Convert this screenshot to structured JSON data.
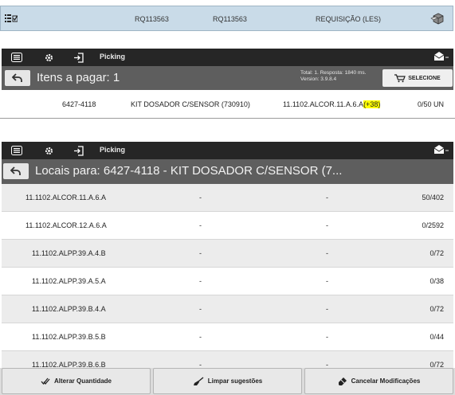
{
  "top_strip": {
    "code_1": "RQ113563",
    "code_2": "RQ113563",
    "type": "REQUISIÇÃO (LES)"
  },
  "panel1": {
    "toolbar_label": "Picking",
    "title": "Itens a pagar: 1",
    "stats_line1": "Total: 1. Resposta: 1840 ms.",
    "stats_line2": "Version: 3.9.8.4",
    "select_button": "SELECIONE",
    "item": {
      "code": "6427-4118",
      "description": "KIT DOSADOR C/SENSOR (730910)",
      "location": "11.1102.ALCOR.11.A.6.A",
      "location_extra": "(+38)",
      "quantity": "0/50 UN"
    }
  },
  "panel2": {
    "toolbar_label": "Picking",
    "title": "Locais para: 6427-4118 - KIT DOSADOR C/SENSOR (7...",
    "rows": [
      {
        "location": "11.1102.ALCOR.11.A.6.A",
        "col2": "-",
        "col3": "-",
        "qty": "50/402"
      },
      {
        "location": "11.1102.ALCOR.12.A.6.A",
        "col2": "-",
        "col3": "-",
        "qty": "0/2592"
      },
      {
        "location": "11.1102.ALPP.39.A.4.B",
        "col2": "-",
        "col3": "-",
        "qty": "0/72"
      },
      {
        "location": "11.1102.ALPP.39.A.5.A",
        "col2": "-",
        "col3": "-",
        "qty": "0/38"
      },
      {
        "location": "11.1102.ALPP.39.B.4.A",
        "col2": "-",
        "col3": "-",
        "qty": "0/72"
      },
      {
        "location": "11.1102.ALPP.39.B.5.B",
        "col2": "-",
        "col3": "-",
        "qty": "0/44"
      },
      {
        "location": "11.1102.ALPP.39.B.6.B",
        "col2": "-",
        "col3": "-",
        "qty": "0/72"
      }
    ]
  },
  "footer": {
    "alter_qty": "Alterar Quantidade",
    "clear_suggestions": "Limpar sugestões",
    "cancel_changes": "Cancelar Modificações"
  }
}
